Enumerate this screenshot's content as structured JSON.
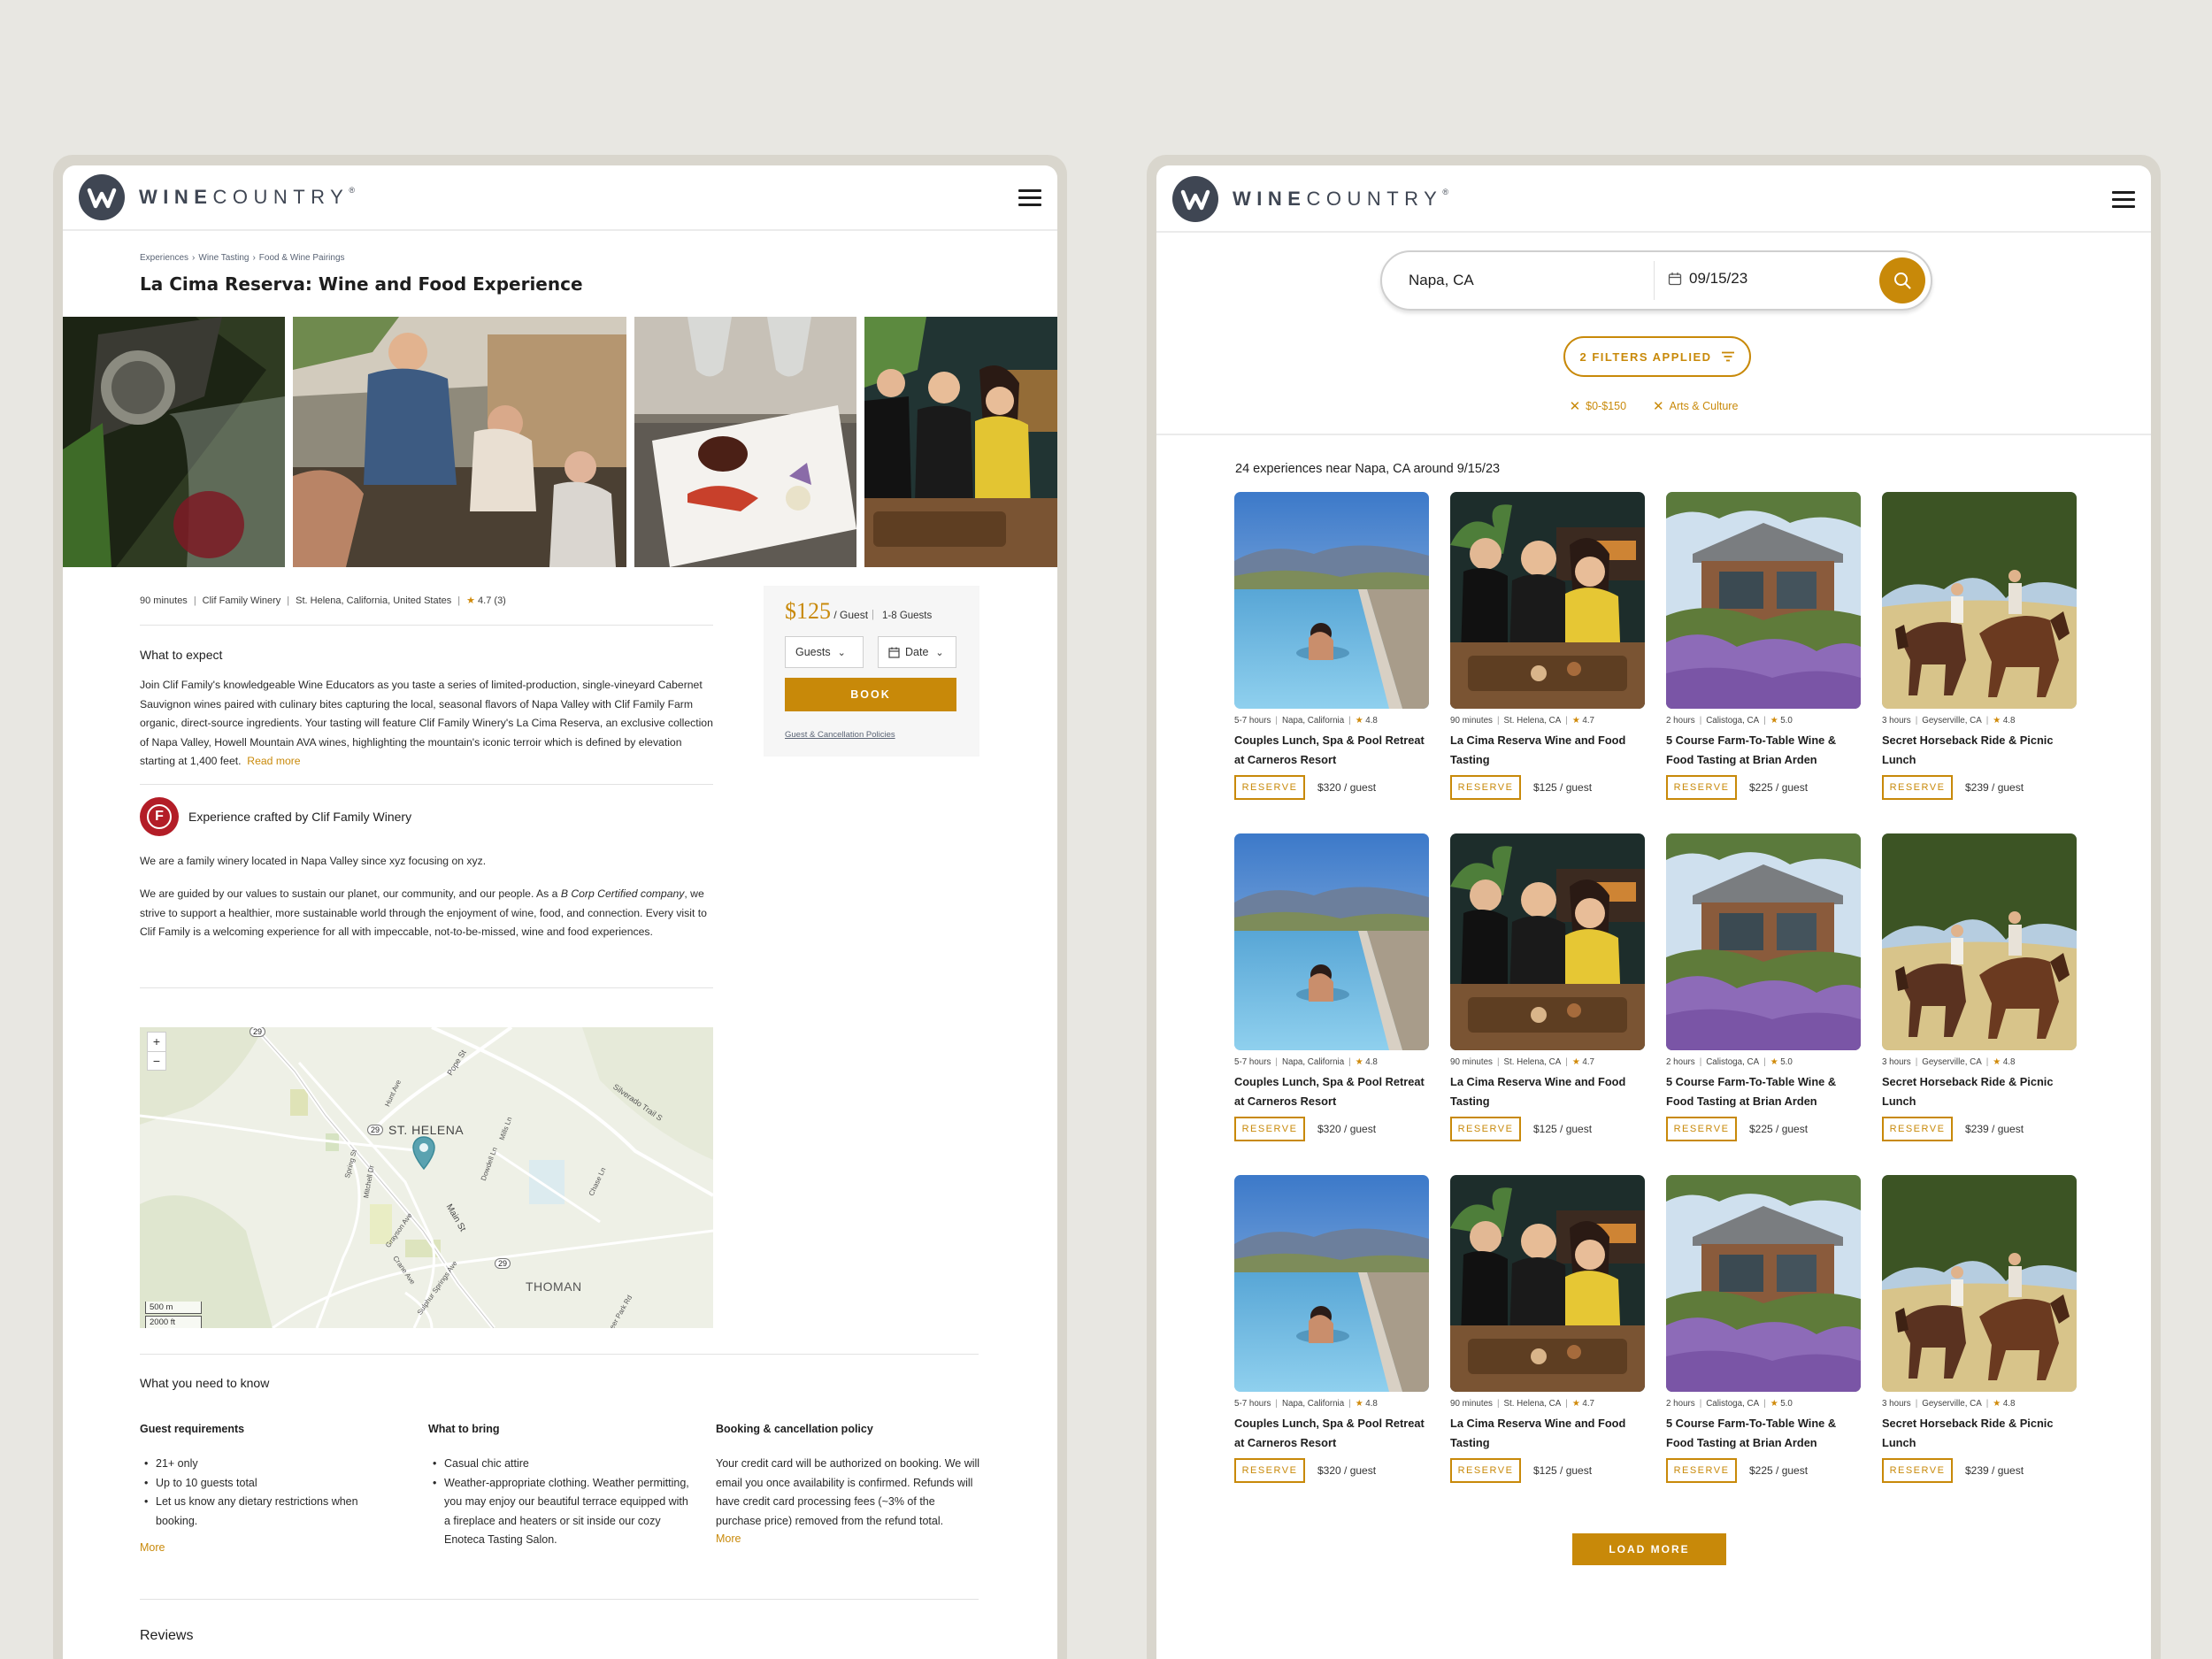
{
  "brand": {
    "bold": "WINE",
    "light": "COUNTRY",
    "reg": "®"
  },
  "detail": {
    "breadcrumb": [
      "Experiences",
      "Wine Tasting",
      "Food & Wine Pairings"
    ],
    "title": "La Cima Reserva: Wine and Food Experience",
    "meta": {
      "duration": "90 minutes",
      "winery": "Clif Family Winery",
      "location": "St. Helena, California, United States",
      "rating": "4.7",
      "count": "(3)"
    },
    "expect_title": "What to expect",
    "expect_text": "Join Clif Family's knowledgeable Wine Educators as you taste a series of limited-production, single-vineyard Cabernet Sauvignon wines paired with culinary bites capturing the local, seasonal flavors of Napa Valley with Clif Family Farm organic, direct-source ingredients. Your tasting will feature Clif Family Winery's La Cima Reserva, an exclusive collection of Napa Valley, Howell Mountain AVA wines, highlighting the mountain's iconic terroir which is defined by elevation starting at 1,400 feet.",
    "read_more": "Read more",
    "crafted_by": "Experience crafted by Clif Family Winery",
    "about_1": "We are a family winery located in Napa Valley since xyz focusing on xyz.",
    "about_2a": "We are guided by our values to sustain our planet, our community, and our people. As a ",
    "about_2b": "B Corp Certified company",
    "about_2c": ", we strive to support a healthier, more sustainable world through the enjoyment of wine, food, and connection. Every visit to Clif Family is a welcoming experience for all with impeccable, not-to-be-missed, wine and food experiences.",
    "booking": {
      "price": "$125",
      "per": "/ Guest",
      "guests_cap": "1-8 Guests",
      "guests_label": "Guests",
      "date_label": "Date",
      "book": "BOOK",
      "policy": "Guest & Cancellation Policies"
    },
    "map": {
      "town": "ST. HELENA",
      "area": "THOMAN",
      "zoom_in": "+",
      "zoom_out": "−",
      "scale_m": "500 m",
      "scale_ft": "2000 ft",
      "route_1": "29",
      "route_2": "29",
      "route_3": "29",
      "streets": [
        "Pope St",
        "Silverado Trail S",
        "Hunt Ave",
        "Mills Ln",
        "Spring St",
        "Mitchell Dr",
        "Main St",
        "Dowdell Ln",
        "Chase Ln",
        "Grayson Ave",
        "Crane Ave",
        "Sulphur Springs Ave",
        "Deer Park Rd"
      ]
    },
    "need_title": "What you need to know",
    "guest_req": {
      "title": "Guest requirements",
      "items": [
        "21+ only",
        "Up to 10 guests total",
        "Let us know any dietary restrictions when booking."
      ],
      "more": "More"
    },
    "bring": {
      "title": "What to bring",
      "items": [
        "Casual chic attire",
        "Weather-appropriate clothing. Weather permitting, you may enjoy our beautiful terrace equipped with a fireplace and heaters or sit inside our cozy Enoteca Tasting Salon."
      ]
    },
    "policy": {
      "title": "Booking & cancellation policy",
      "text": "Your credit card will be authorized on booking. We will email you once availability is confirmed. Refunds will have credit card processing fees (~3% of the purchase price) removed from the refund total.",
      "more": "More"
    },
    "reviews_title": "Reviews"
  },
  "search": {
    "location": "Napa, CA",
    "date": "09/15/23",
    "filters_label": "2 FILTERS APPLIED",
    "chips": [
      "$0-$150",
      "Arts & Culture"
    ],
    "results": "24 experiences near Napa, CA around 9/15/23",
    "reserve": "RESERVE",
    "load_more": "LOAD MORE",
    "cards": [
      {
        "duration": "5-7 hours",
        "location": "Napa, California",
        "rating": "4.8",
        "title": "Couples Lunch, Spa  & Pool Retreat at Carneros Resort",
        "price": "$320 / guest",
        "img": "pool"
      },
      {
        "duration": "90 minutes",
        "location": "St. Helena, CA",
        "rating": "4.7",
        "title": "La Cima Reserva Wine and Food Tasting",
        "price": "$125 / guest",
        "img": "dinner"
      },
      {
        "duration": "2 hours",
        "location": "Calistoga, CA",
        "rating": "5.0",
        "title": "5 Course Farm-To-Table Wine & Food Tasting at Brian Arden",
        "price": "$225 / guest",
        "img": "house"
      },
      {
        "duration": "3 hours",
        "location": "Geyserville, CA",
        "rating": "4.8",
        "title": "Secret Horseback Ride & Picnic Lunch",
        "price": "$239 / guest",
        "img": "horse"
      }
    ]
  }
}
